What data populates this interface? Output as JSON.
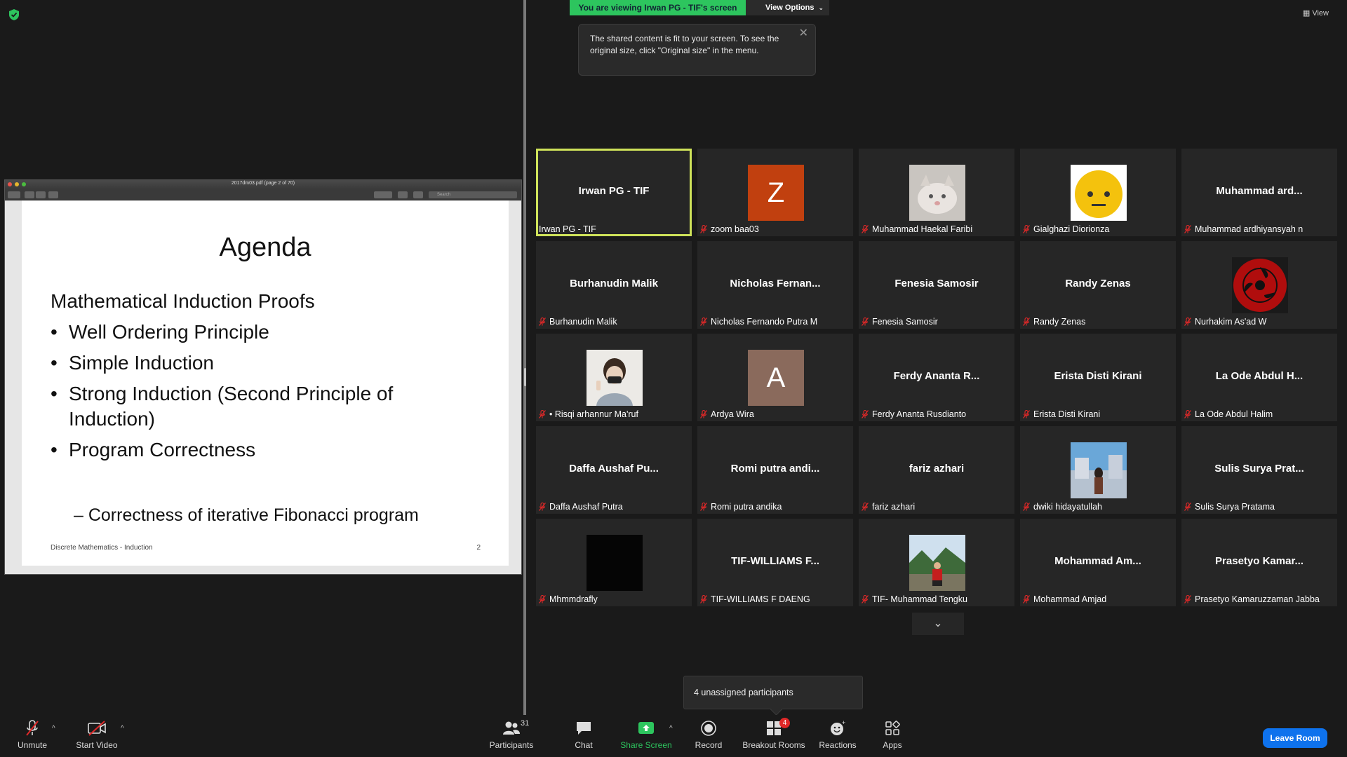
{
  "top": {
    "viewing_banner": "You are viewing Irwan PG - TIF's screen",
    "view_options": "View Options",
    "view_button": "View",
    "tooltip_text": "The shared content is fit to your screen. To see the original size, click \"Original size\" in the menu."
  },
  "pdf": {
    "file_title": "2017dm03.pdf (page 2 of 70)",
    "search_placeholder": "Search",
    "slide": {
      "title": "Agenda",
      "heading": "Mathematical Induction Proofs",
      "bullets": [
        "Well Ordering Principle",
        "Simple Induction",
        "Strong Induction (Second Principle of Induction)",
        "Program Correctness"
      ],
      "sub_bullet": "– Correctness of iterative Fibonacci program",
      "footer": "Discrete Mathematics - Induction",
      "page_number": "2"
    }
  },
  "gallery": {
    "tiles": [
      {
        "center": "Irwan PG - TIF",
        "label": "Irwan PG - TIF",
        "muted": false,
        "active": true
      },
      {
        "center": "",
        "label": "zoom baa03",
        "muted": true,
        "avatar": "letter",
        "letter": "Z",
        "color": "#c1400f"
      },
      {
        "center": "",
        "label": "Muhammad Haekal Faribi",
        "muted": true,
        "avatar": "photo-cat"
      },
      {
        "center": "",
        "label": "Gialghazi Diorionza",
        "muted": true,
        "avatar": "photo-emoji"
      },
      {
        "center": "Muhammad  ard...",
        "label": "Muhammad ardhiyansyah n",
        "muted": true
      },
      {
        "center": "Burhanudin Malik",
        "label": "Burhanudin Malik",
        "muted": true
      },
      {
        "center": "Nicholas  Fernan...",
        "label": "Nicholas Fernando Putra M",
        "muted": true
      },
      {
        "center": "Fenesia Samosir",
        "label": "Fenesia Samosir",
        "muted": true
      },
      {
        "center": "Randy Zenas",
        "label": "Randy Zenas",
        "muted": true
      },
      {
        "center": "",
        "label": "Nurhakim As'ad W",
        "muted": true,
        "avatar": "photo-sharingan"
      },
      {
        "center": "",
        "label": "• Risqi arhannur Ma'ruf",
        "muted": true,
        "avatar": "photo-person"
      },
      {
        "center": "",
        "label": "Ardya Wira",
        "muted": true,
        "avatar": "letter",
        "letter": "A",
        "color": "#8a6a5c"
      },
      {
        "center": "Ferdy Ananta R...",
        "label": "Ferdy Ananta Rusdianto",
        "muted": true
      },
      {
        "center": "Erista Disti Kirani",
        "label": "Erista Disti Kirani",
        "muted": true
      },
      {
        "center": "La Ode Abdul H...",
        "label": "La Ode Abdul Halim",
        "muted": true
      },
      {
        "center": "Daffa Aushaf Pu...",
        "label": "Daffa Aushaf Putra",
        "muted": true
      },
      {
        "center": "Romi putra andi...",
        "label": "Romi putra andika",
        "muted": true
      },
      {
        "center": "fariz azhari",
        "label": "fariz azhari",
        "muted": true
      },
      {
        "center": "",
        "label": "dwiki hidayatullah",
        "muted": true,
        "avatar": "photo-street"
      },
      {
        "center": "Sulis Surya Prat...",
        "label": "Sulis Surya Pratama",
        "muted": true
      },
      {
        "center": "",
        "label": "Mhmmdrafly",
        "muted": true,
        "avatar": "photo-black"
      },
      {
        "center": "TIF-WILLIAMS F...",
        "label": "TIF-WILLIAMS F DAENG",
        "muted": true
      },
      {
        "center": "",
        "label": "TIF- Muhammad Tengku",
        "muted": true,
        "avatar": "photo-outdoor"
      },
      {
        "center": "Mohammad  Am...",
        "label": "Mohammad Amjad",
        "muted": true
      },
      {
        "center": "Prasetyo  Kamar...",
        "label": "Prasetyo Kamaruzzaman Jabba",
        "muted": true
      }
    ]
  },
  "unassigned_tip": "4 unassigned participants",
  "toolbar": {
    "unmute": "Unmute",
    "start_video": "Start Video",
    "participants": "Participants",
    "participants_count": "31",
    "chat": "Chat",
    "share_screen": "Share Screen",
    "record": "Record",
    "breakout_rooms": "Breakout Rooms",
    "breakout_badge": "4",
    "reactions": "Reactions",
    "apps": "Apps",
    "leave_room": "Leave Room"
  },
  "colors": {
    "banner_green": "#2dc55e",
    "active_border": "#cfe35a",
    "leave_blue": "#0e72ed",
    "mute_red": "#e02828"
  }
}
